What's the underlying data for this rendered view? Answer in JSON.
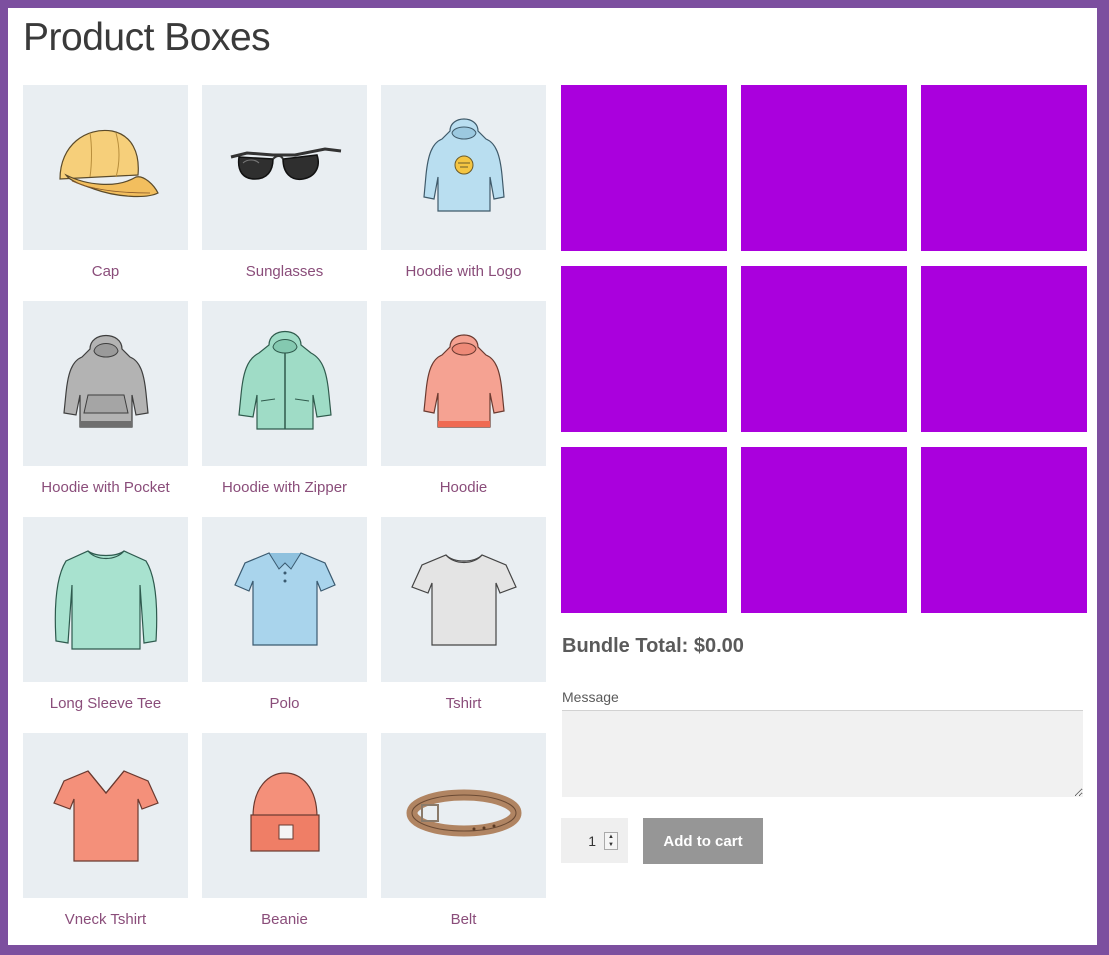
{
  "page": {
    "title": "Product Boxes"
  },
  "products": [
    {
      "name": "Cap",
      "icon": "cap-icon"
    },
    {
      "name": "Sunglasses",
      "icon": "sunglasses-icon"
    },
    {
      "name": "Hoodie with Logo",
      "icon": "hoodie-with-logo-icon"
    },
    {
      "name": "Hoodie with Pocket",
      "icon": "hoodie-with-pocket-icon"
    },
    {
      "name": "Hoodie with Zipper",
      "icon": "hoodie-with-zipper-icon"
    },
    {
      "name": "Hoodie",
      "icon": "hoodie-icon"
    },
    {
      "name": "Long Sleeve Tee",
      "icon": "long-sleeve-tee-icon"
    },
    {
      "name": "Polo",
      "icon": "polo-icon"
    },
    {
      "name": "Tshirt",
      "icon": "tshirt-icon"
    },
    {
      "name": "Vneck Tshirt",
      "icon": "vneck-tshirt-icon"
    },
    {
      "name": "Beanie",
      "icon": "beanie-icon"
    },
    {
      "name": "Belt",
      "icon": "belt-icon"
    }
  ],
  "bundle": {
    "total_text": "Bundle Total: $0.00",
    "message_label": "Message",
    "message_value": "",
    "quantity": "1",
    "add_to_cart_label": "Add to cart",
    "empty_slot_color": "#aa00dd"
  },
  "colors": {
    "frame": "#7c4f9f",
    "product_link": "#8a4d7a",
    "thumb_background": "#e9eef2",
    "button_background": "#969696"
  }
}
